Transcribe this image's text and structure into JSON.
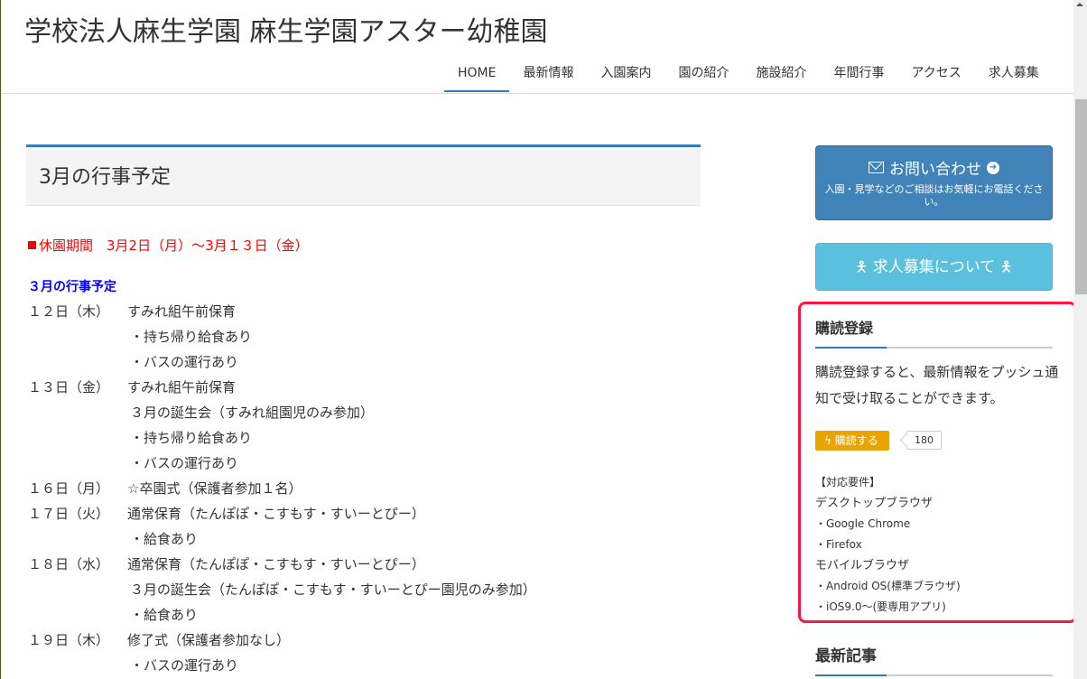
{
  "header": {
    "site_title": "学校法人麻生学園 麻生学園アスター幼稚園",
    "nav": [
      {
        "label": "HOME",
        "active": true
      },
      {
        "label": "最新情報"
      },
      {
        "label": "入園案内"
      },
      {
        "label": "園の紹介"
      },
      {
        "label": "施設紹介"
      },
      {
        "label": "年間行事"
      },
      {
        "label": "アクセス"
      },
      {
        "label": "求人募集"
      }
    ]
  },
  "main": {
    "page_title": "3月の行事予定",
    "notice_icon": "red-square",
    "notice": "休園期間　3月2日（月）～3月１３日（金）",
    "schedule_title": "３月の行事予定",
    "schedule": [
      {
        "date": "１２日（木）",
        "desc": "すみれ組午前保育"
      },
      {
        "date": "",
        "desc": "・持ち帰り給食あり"
      },
      {
        "date": "",
        "desc": "・バスの運行あり"
      },
      {
        "date": "１３日（金）",
        "desc": "すみれ組午前保育"
      },
      {
        "date": "",
        "desc": "３月の誕生会（すみれ組園児のみ参加）"
      },
      {
        "date": "",
        "desc": "・持ち帰り給食あり"
      },
      {
        "date": "",
        "desc": "・バスの運行あり"
      },
      {
        "date": "１６日（月）",
        "desc": "☆卒園式（保護者参加１名）"
      },
      {
        "date": "１７日（火）",
        "desc": "通常保育（たんぽぽ・こすもす・すいーとぴー）"
      },
      {
        "date": "",
        "desc": "・給食あり"
      },
      {
        "date": "１８日（水）",
        "desc": "通常保育（たんぽぽ・こすもす・すいーとぴー）"
      },
      {
        "date": "",
        "desc": "３月の誕生会（たんぽぽ・こすもす・すいーとぴー園児のみ参加）"
      },
      {
        "date": "",
        "desc": "・給食あり"
      },
      {
        "date": "１９日（木）",
        "desc": "修了式（保護者参加なし）"
      },
      {
        "date": "",
        "desc": "・バスの運行あり"
      }
    ]
  },
  "sidebar": {
    "contact": {
      "icon": "envelope-icon",
      "label": "お問い合わせ",
      "arrow_icon": "arrow-circle-right-icon",
      "sub": "入園・見学などのご相談はお気軽にお電話ください。"
    },
    "recruit": {
      "icon": "person-icon",
      "label": "求人募集について"
    },
    "subscribe": {
      "title": "購読登録",
      "description": "購読登録すると、最新情報をプッシュ通知で受け取ることができます。",
      "button_icon": "lightning-icon",
      "button_label": "購読する",
      "count": "180",
      "requirements_title": "【対応要件】",
      "desktop_label": "デスクトップブラウザ",
      "desktop_items": [
        "・Google Chrome",
        "・Firefox"
      ],
      "mobile_label": "モバイルブラウザ",
      "mobile_items": [
        "・Android OS(標準ブラウザ)",
        "・iOS9.0～(要専用アプリ)"
      ],
      "highlight_color": "#ff1744"
    },
    "recent_title": "最新記事"
  },
  "colors": {
    "accent": "#337ab7",
    "contact_button": "#3f83b8",
    "recruit_button": "#5bc0de",
    "subscribe_button": "#e9a400",
    "notice_text": "#ff0000",
    "schedule_title": "#0000ff"
  }
}
